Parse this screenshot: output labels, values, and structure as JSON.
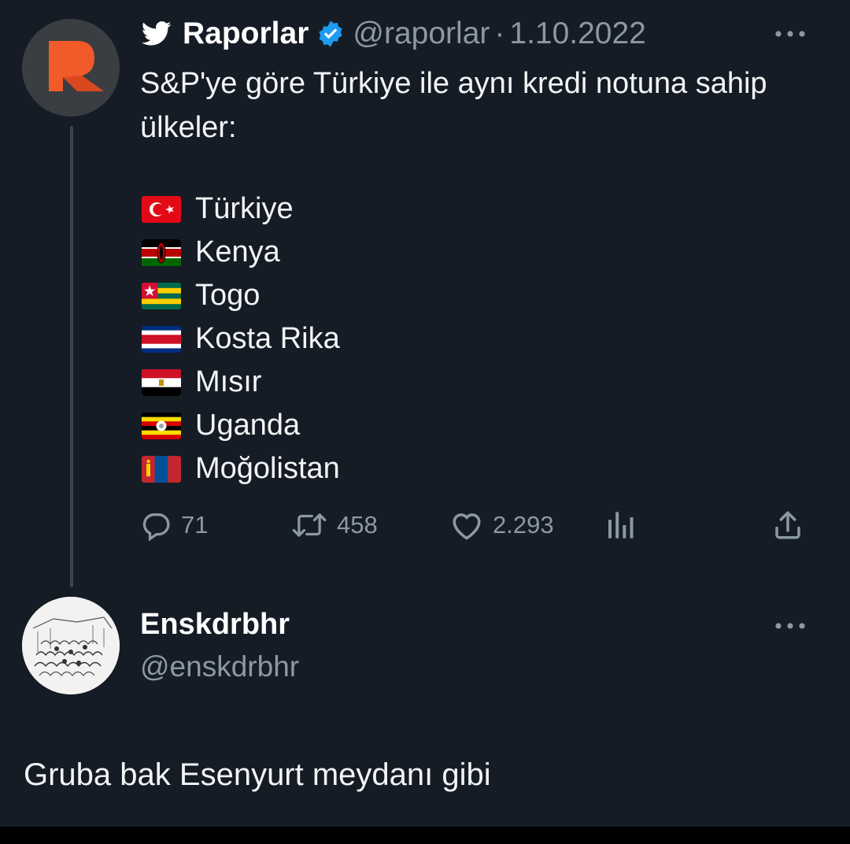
{
  "colors": {
    "background": "#151c26",
    "text_primary": "#f2f4f5",
    "text_secondary": "#8b98a5",
    "verified_blue": "#1d9bf0",
    "logo_orange": "#f15a29"
  },
  "main_tweet": {
    "display_name": "Raporlar",
    "handle": "@raporlar",
    "separator": "·",
    "date": "1.10.2022",
    "text": "S&P'ye göre Türkiye ile aynı kredi notuna sahip ülkeler:",
    "countries": [
      {
        "flag": "flag-turkey",
        "name": "Türkiye"
      },
      {
        "flag": "flag-kenya",
        "name": "Kenya"
      },
      {
        "flag": "flag-togo",
        "name": "Togo"
      },
      {
        "flag": "flag-costa-rica",
        "name": "Kosta Rika"
      },
      {
        "flag": "flag-egypt",
        "name": "Mısır"
      },
      {
        "flag": "flag-uganda",
        "name": "Uganda"
      },
      {
        "flag": "flag-mongolia",
        "name": "Moğolistan"
      }
    ],
    "actions": {
      "replies": "71",
      "retweets": "458",
      "likes": "2.293"
    }
  },
  "reply_tweet": {
    "display_name": "Enskdrbhr",
    "handle": "@enskdrbhr",
    "text": "Gruba bak Esenyurt meydanı gibi"
  },
  "icons": [
    "twitter-bird-icon",
    "verified-badge-icon",
    "more-icon",
    "reply-icon",
    "retweet-icon",
    "like-icon",
    "analytics-icon",
    "share-icon"
  ]
}
